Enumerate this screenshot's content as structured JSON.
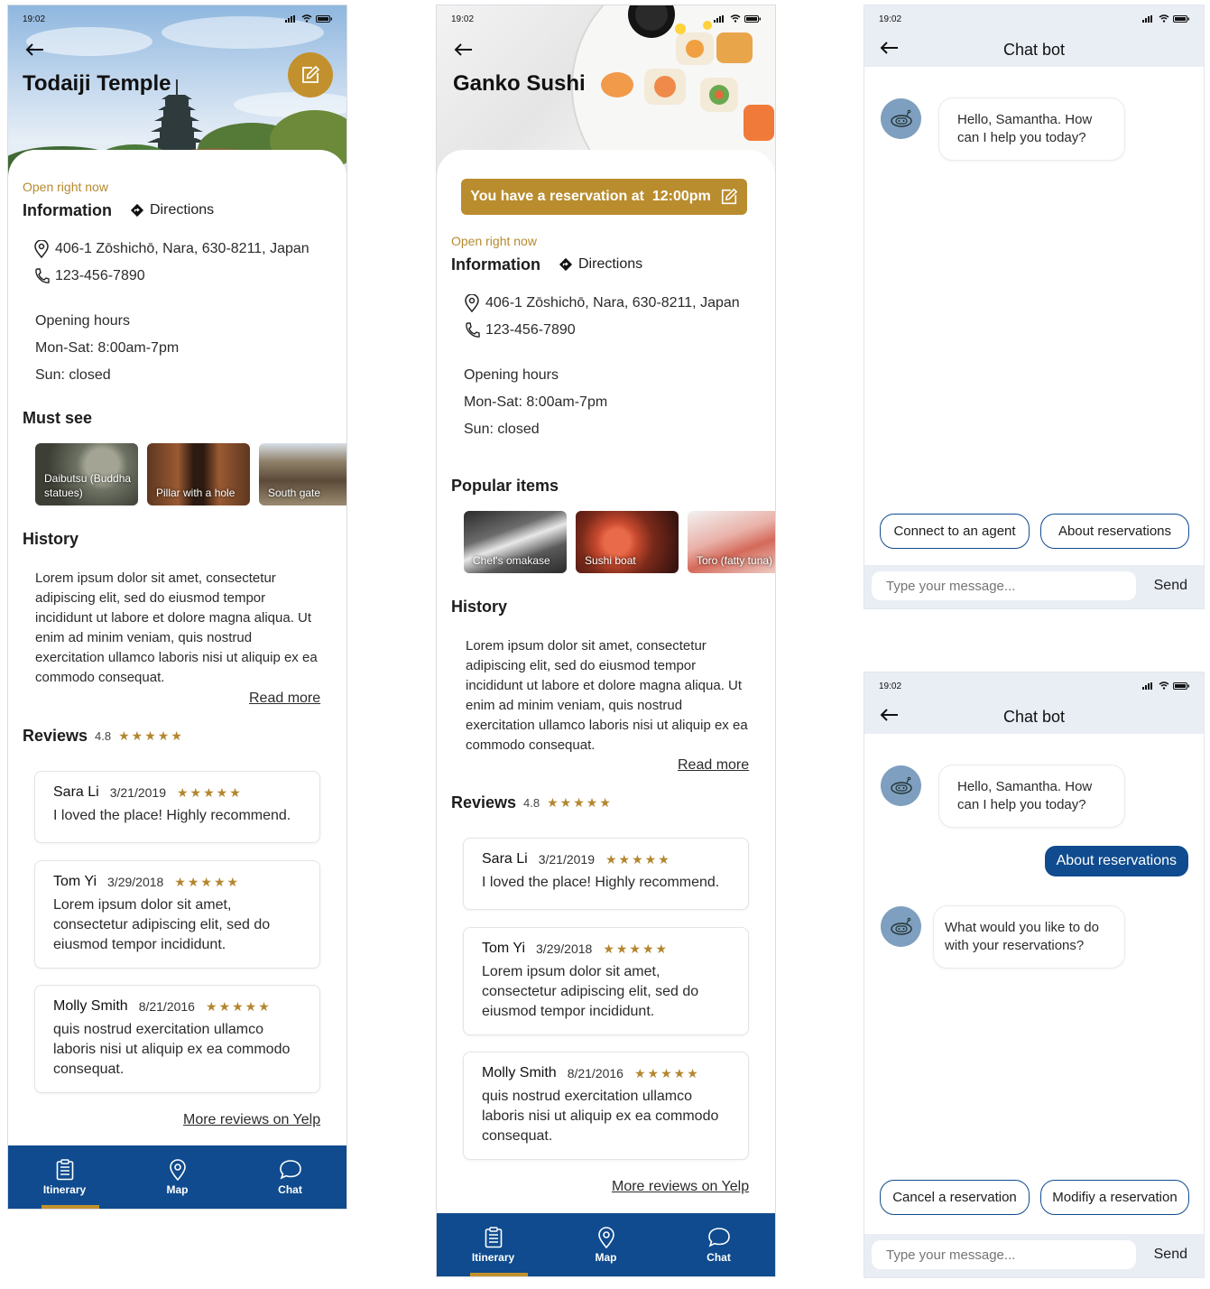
{
  "screens": {
    "temple": {
      "status_time": "19:02",
      "title": "Todaiji Temple",
      "open_now": "Open right now",
      "info_heading": "Information",
      "directions": "Directions",
      "address": "406-1 Zōshichō, Nara, 630-8211, Japan",
      "phone": "123-456-7890",
      "hours_heading": "Opening hours",
      "hours_weekday": "Mon-Sat: 8:00am-7pm",
      "hours_sunday": "Sun: closed",
      "must_see_heading": "Must see",
      "must_see": [
        "Daibutsu (Buddha statues)",
        "Pillar with a hole",
        "South gate"
      ],
      "history_heading": "History",
      "history_text": "Lorem ipsum dolor sit amet, consectetur adipiscing elit, sed do eiusmod tempor incididunt ut labore et dolore magna aliqua. Ut enim ad minim veniam, quis nostrud exercitation ullamco laboris nisi ut aliquip ex ea commodo consequat.",
      "read_more": "Read more",
      "reviews_heading": "Reviews",
      "rating": "4.8",
      "reviews": [
        {
          "name": "Sara Li",
          "date": "3/21/2019",
          "stars": "★★★★★",
          "text": "I loved the place! Highly recommend."
        },
        {
          "name": "Tom Yi",
          "date": "3/29/2018",
          "stars": "★★★★★",
          "text": "Lorem ipsum dolor sit amet, consectetur adipiscing elit, sed do eiusmod tempor incididunt."
        },
        {
          "name": "Molly Smith",
          "date": "8/21/2016",
          "stars": "★★★★★",
          "text": "quis nostrud exercitation ullamco laboris nisi ut aliquip ex ea commodo consequat."
        }
      ],
      "more_reviews": "More reviews on Yelp",
      "nav": [
        "Itinerary",
        "Map",
        "Chat"
      ]
    },
    "sushi": {
      "status_time": "19:02",
      "title": "Ganko Sushi",
      "reservation": "You have a reservation at  12:00pm",
      "open_now": "Open right now",
      "info_heading": "Information",
      "directions": "Directions",
      "address": "406-1 Zōshichō, Nara, 630-8211, Japan",
      "phone": "123-456-7890",
      "hours_heading": "Opening hours",
      "hours_weekday": "Mon-Sat: 8:00am-7pm",
      "hours_sunday": "Sun: closed",
      "popular_heading": "Popular items",
      "popular": [
        "Chef's omakase",
        "Sushi boat",
        "Toro (fatty tuna)"
      ],
      "history_heading": "History",
      "history_text": "Lorem ipsum dolor sit amet, consectetur adipiscing elit, sed do eiusmod tempor incididunt ut labore et dolore magna aliqua. Ut enim ad minim veniam, quis nostrud exercitation ullamco laboris nisi ut aliquip ex ea commodo consequat.",
      "read_more": "Read more",
      "reviews_heading": "Reviews",
      "rating": "4.8",
      "reviews": [
        {
          "name": "Sara Li",
          "date": "3/21/2019",
          "stars": "★★★★★",
          "text": "I loved the place! Highly recommend."
        },
        {
          "name": "Tom Yi",
          "date": "3/29/2018",
          "stars": "★★★★★",
          "text": "Lorem ipsum dolor sit amet, consectetur adipiscing elit, sed do eiusmod tempor incididunt."
        },
        {
          "name": "Molly Smith",
          "date": "8/21/2016",
          "stars": "★★★★★",
          "text": "quis nostrud exercitation ullamco laboris nisi ut aliquip ex ea commodo consequat."
        }
      ],
      "more_reviews": "More reviews on Yelp",
      "nav": [
        "Itinerary",
        "Map",
        "Chat"
      ]
    },
    "chat1": {
      "status_time": "19:02",
      "title": "Chat bot",
      "bot_greeting": "Hello, Samantha. How can I help you today?",
      "chips": [
        "Connect to an agent",
        "About reservations"
      ],
      "placeholder": "Type your message...",
      "send": "Send"
    },
    "chat2": {
      "status_time": "19:02",
      "title": "Chat bot",
      "bot_greeting": "Hello, Samantha. How can I help you today?",
      "user_message": "About reservations",
      "bot_followup": "What would you like to do with your reservations?",
      "chips": [
        "Cancel a reservation",
        "Modifiy a reservation"
      ],
      "placeholder": "Type your message...",
      "send": "Send"
    }
  },
  "colors": {
    "brand_blue": "#0f4b8e",
    "gold": "#c2912d",
    "chat_bg": "#e9eef5"
  },
  "icons": [
    "back-arrow-icon",
    "edit-icon",
    "directions-icon",
    "location-pin-icon",
    "phone-icon",
    "star-icon",
    "itinerary-icon",
    "map-pin-icon",
    "chat-bubble-icon",
    "robot-icon",
    "signal-icon",
    "wifi-icon",
    "battery-icon"
  ]
}
